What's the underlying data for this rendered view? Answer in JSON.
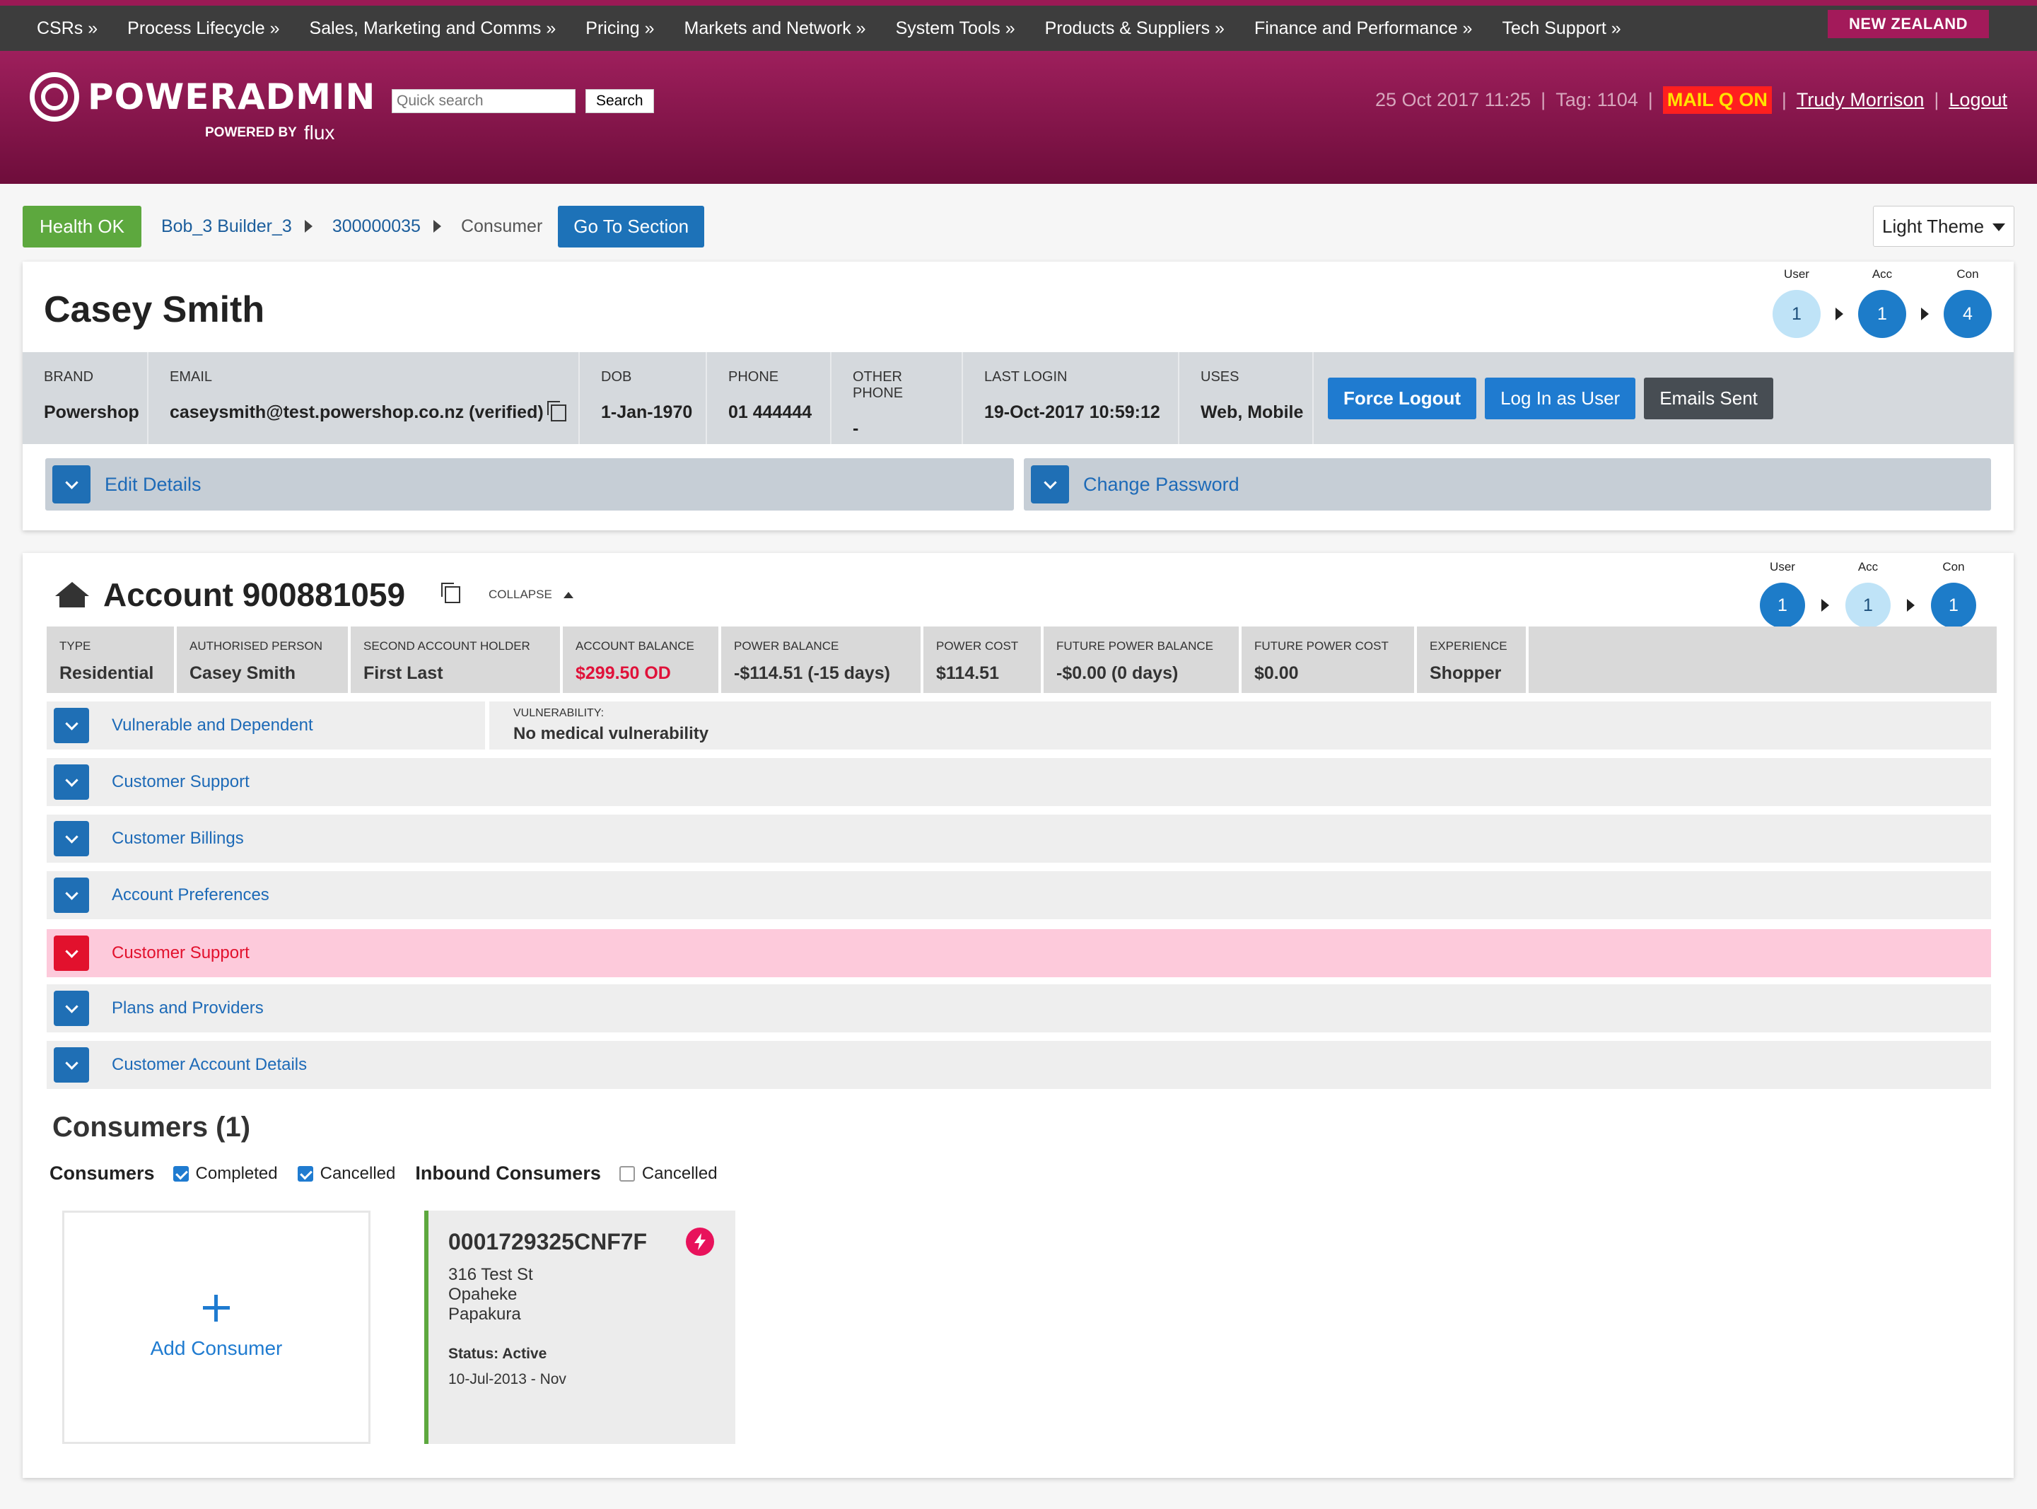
{
  "nav": {
    "items": [
      "CSRs »",
      "Process Lifecycle »",
      "Sales, Marketing and Comms »",
      "Pricing »",
      "Markets and Network »",
      "System Tools »",
      "Products & Suppliers »",
      "Finance and Performance »",
      "Tech Support »"
    ],
    "region": "NEW ZEALAND"
  },
  "header": {
    "logo_text": "POWERADMIN",
    "powered_by": "POWERED BY",
    "powered_brand": "flux",
    "search_placeholder": "Quick search",
    "search_button": "Search",
    "datetime": "25 Oct 2017 11:25",
    "tag": "Tag: 1104",
    "mail_q": "MAIL Q ON",
    "user": "Trudy Morrison",
    "logout": "Logout",
    "colors": {
      "brand": "#9e1f5c",
      "mail_q_bg": "#ff1f1f",
      "mail_q_fg": "#ffe200"
    }
  },
  "crumbs": {
    "health": "Health OK",
    "path": [
      "Bob_3 Builder_3",
      "300000035",
      "Consumer"
    ],
    "goto": "Go To Section",
    "theme": "Light Theme"
  },
  "user_card": {
    "name": "Casey Smith",
    "levels": [
      {
        "label": "User",
        "value": "1"
      },
      {
        "label": "Acc",
        "value": "1"
      },
      {
        "label": "Con",
        "value": "4"
      }
    ],
    "fields": [
      {
        "key": "BRAND",
        "value": "Powershop"
      },
      {
        "key": "EMAIL",
        "value": "caseysmith@test.powershop.co.nz (verified)"
      },
      {
        "key": "DOB",
        "value": "1-Jan-1970"
      },
      {
        "key": "PHONE",
        "value": "01 444444"
      },
      {
        "key": "OTHER PHONE",
        "value": "-"
      },
      {
        "key": "LAST LOGIN",
        "value": "19-Oct-2017 10:59:12"
      },
      {
        "key": "USES",
        "value": "Web, Mobile"
      }
    ],
    "buttons": {
      "force_logout": "Force Logout",
      "login_as": "Log In as User",
      "emails_sent": "Emails Sent"
    },
    "accordions": {
      "edit": "Edit Details",
      "password": "Change Password"
    }
  },
  "account": {
    "title": "Account 900881059",
    "collapse": "COLLAPSE",
    "levels": [
      {
        "label": "User",
        "value": "1"
      },
      {
        "label": "Acc",
        "value": "1"
      },
      {
        "label": "Con",
        "value": "1"
      }
    ],
    "fields": [
      {
        "key": "TYPE",
        "value": "Residential"
      },
      {
        "key": "AUTHORISED PERSON",
        "value": "Casey Smith"
      },
      {
        "key": "SECOND ACCOUNT HOLDER",
        "value": "First Last"
      },
      {
        "key": "ACCOUNT BALANCE",
        "value": "$299.50 OD"
      },
      {
        "key": "POWER BALANCE",
        "value": "-$114.51 (-15 days)"
      },
      {
        "key": "POWER COST",
        "value": "$114.51"
      },
      {
        "key": "FUTURE POWER BALANCE",
        "value": "-$0.00 (0 days)"
      },
      {
        "key": "FUTURE POWER COST",
        "value": "$0.00"
      },
      {
        "key": "EXPERIENCE",
        "value": "Shopper"
      }
    ],
    "vulnerability": {
      "label": "Vulnerable and Dependent",
      "key": "VULNERABILITY:",
      "value": "No medical vulnerability"
    },
    "sections": [
      "Customer Support",
      "Customer Billings",
      "Account Preferences",
      "Customer Support",
      "Plans and Providers",
      "Customer Account Details"
    ],
    "consumers": {
      "heading": "Consumers (1)",
      "group1": "Consumers",
      "completed": "Completed",
      "cancelled": "Cancelled",
      "group2": "Inbound Consumers",
      "inbound_cancelled": "Cancelled",
      "add": "Add Consumer",
      "card": {
        "id": "0001729325CNF7F",
        "address": [
          "316 Test St",
          "Opaheke",
          "Papakura"
        ],
        "status": "Status: Active",
        "dates": "10-Jul-2013 - Nov"
      }
    }
  }
}
